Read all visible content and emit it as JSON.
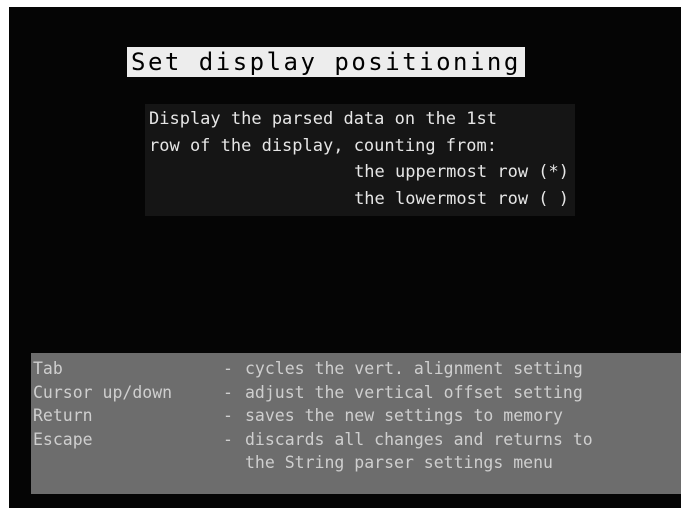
{
  "title": "Set display positioning",
  "description": {
    "line1": "Display the parsed data on the 1st",
    "line2": "row of the display, counting from:",
    "options": [
      {
        "label": "the uppermost row (*)"
      },
      {
        "label": "the lowermost row ( )"
      }
    ]
  },
  "help": {
    "rows": [
      {
        "key": "Tab",
        "sep": "-",
        "text": "cycles the vert. alignment setting"
      },
      {
        "key": "Cursor up/down",
        "sep": "-",
        "text": "adjust the vertical offset setting"
      },
      {
        "key": "Return",
        "sep": "-",
        "text": "saves the new settings to memory"
      },
      {
        "key": "Escape",
        "sep": "-",
        "text": "discards all changes and returns to"
      }
    ],
    "continuation": "the String parser settings menu"
  }
}
